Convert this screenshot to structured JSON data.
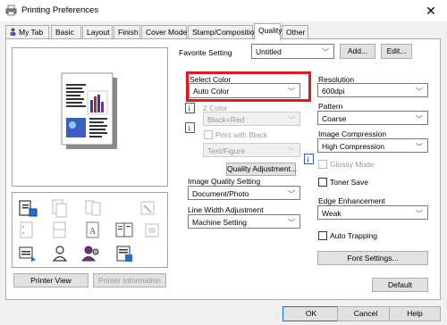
{
  "window": {
    "title": "Printing Preferences",
    "close_glyph": "✕"
  },
  "tabs": [
    "My Tab",
    "Basic",
    "Layout",
    "Finish",
    "Cover Mode",
    "Stamp/Composition",
    "Quality",
    "Other"
  ],
  "active_tab": "Quality",
  "favorite": {
    "label": "Favorite Setting",
    "value": "Untitled",
    "add_label": "Add...",
    "edit_label": "Edit..."
  },
  "select_color": {
    "label": "Select Color",
    "value": "Auto Color"
  },
  "two_color": {
    "label": "2 Color",
    "value": "Black+Red"
  },
  "print_with_black": {
    "label": "Print with Black",
    "value": "Text/Figure"
  },
  "quality_adjustment_label": "Quality Adjustment...",
  "image_quality": {
    "label": "Image Quality Setting",
    "value": "Document/Photo"
  },
  "line_width": {
    "label": "Line Width Adjustment",
    "value": "Machine Setting"
  },
  "resolution": {
    "label": "Resolution",
    "value": "600dpi"
  },
  "pattern": {
    "label": "Pattern",
    "value": "Coarse"
  },
  "image_compression": {
    "label": "Image Compression",
    "value": "High Compression"
  },
  "glossy_mode_label": "Glossy Mode",
  "toner_save_label": "Toner Save",
  "edge_enhancement": {
    "label": "Edge Enhancement",
    "value": "Weak"
  },
  "auto_trapping_label": "Auto Trapping",
  "font_settings_label": "Font Settings...",
  "default_label": "Default",
  "printer_view_label": "Printer View",
  "printer_information_label": "Printer Information",
  "footer": {
    "ok": "OK",
    "cancel": "Cancel",
    "help": "Help"
  },
  "colors": {
    "accent": "#0078d7",
    "highlight": "#e1191e"
  }
}
